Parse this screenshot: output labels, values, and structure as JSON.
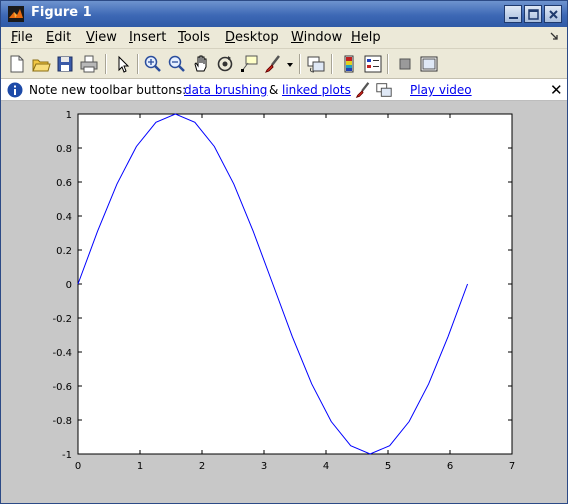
{
  "window": {
    "title": "Figure 1"
  },
  "menu": {
    "items": [
      "File",
      "Edit",
      "View",
      "Insert",
      "Tools",
      "Desktop",
      "Window",
      "Help"
    ],
    "underline": [
      "F",
      "E",
      "V",
      "I",
      "T",
      "D",
      "W",
      "H"
    ]
  },
  "toolbar": {
    "buttons": [
      {
        "name": "new-figure-icon"
      },
      {
        "name": "open-file-icon"
      },
      {
        "name": "save-icon"
      },
      {
        "name": "print-icon"
      },
      {
        "name": "edit-plot-arrow-icon"
      },
      {
        "name": "zoom-in-icon"
      },
      {
        "name": "zoom-out-icon"
      },
      {
        "name": "pan-hand-icon"
      },
      {
        "name": "rotate-3d-icon"
      },
      {
        "name": "data-cursor-icon"
      },
      {
        "name": "brush-icon"
      },
      {
        "name": "brush-dropdown-icon"
      },
      {
        "name": "link-plot-icon"
      },
      {
        "name": "colorbar-icon"
      },
      {
        "name": "legend-icon"
      },
      {
        "name": "hide-plot-tools-icon"
      },
      {
        "name": "show-plot-tools-icon"
      }
    ]
  },
  "infobar": {
    "note": "Note new toolbar buttons:",
    "link_brushing": "data brushing",
    "ampersand": "&",
    "link_linked": "linked plots",
    "link_video": "Play video",
    "close": "✕"
  },
  "colors": {
    "line": "#0000ff",
    "figure_bg": "#c8c8c8",
    "title_bar": "#3d68b5"
  },
  "chart_data": {
    "type": "line",
    "title": "",
    "xlabel": "",
    "ylabel": "",
    "xlim": [
      0,
      7
    ],
    "ylim": [
      -1,
      1
    ],
    "xticks": [
      "0",
      "1",
      "2",
      "3",
      "4",
      "5",
      "6",
      "7"
    ],
    "yticks": [
      "-1",
      "-0.8",
      "-0.6",
      "-0.4",
      "-0.2",
      "0",
      "0.2",
      "0.4",
      "0.6",
      "0.8",
      "1"
    ],
    "grid": false,
    "series": [
      {
        "x": [
          0,
          0.314,
          0.628,
          0.942,
          1.257,
          1.571,
          1.885,
          2.199,
          2.513,
          2.827,
          3.142,
          3.456,
          3.77,
          4.084,
          4.398,
          4.712,
          5.027,
          5.341,
          5.655,
          5.969,
          6.283
        ],
        "y": [
          0,
          0.309,
          0.588,
          0.809,
          0.951,
          1.0,
          0.951,
          0.809,
          0.588,
          0.309,
          0,
          -0.309,
          -0.588,
          -0.809,
          -0.951,
          -1.0,
          -0.951,
          -0.809,
          -0.588,
          -0.309,
          0
        ]
      }
    ]
  }
}
